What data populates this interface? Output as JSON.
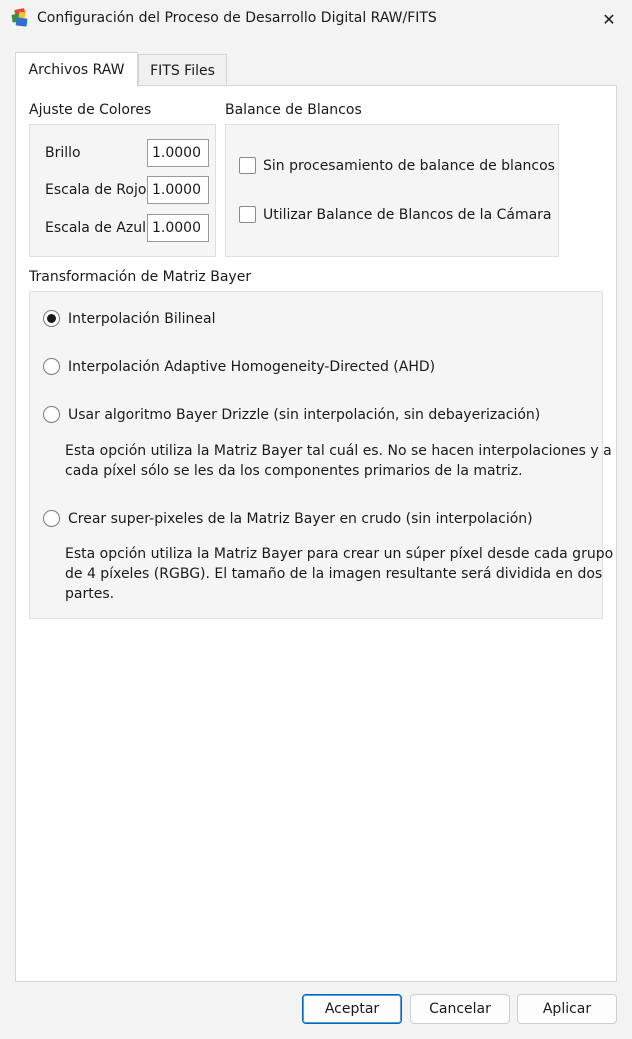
{
  "window": {
    "title": "Configuración del Proceso de Desarrollo Digital RAW/FITS",
    "close_glyph": "✕"
  },
  "tabs": [
    {
      "label": "Archivos RAW",
      "active": true
    },
    {
      "label": "FITS Files",
      "active": false
    }
  ],
  "color_adjust": {
    "group_label": "Ajuste de Colores",
    "brightness_label": "Brillo",
    "brightness_value": "1.0000",
    "red_scale_label": "Escala de Rojo",
    "red_scale_value": "1.0000",
    "blue_scale_label": "Escala de Azul",
    "blue_scale_value": "1.0000"
  },
  "white_balance": {
    "group_label": "Balance de Blancos",
    "no_processing_label": "Sin procesamiento de balance de blancos",
    "no_processing_checked": false,
    "camera_wb_label": "Utilizar Balance de Blancos de la Cámara",
    "camera_wb_checked": false
  },
  "bayer": {
    "group_label": "Transformación de Matriz Bayer",
    "options": [
      {
        "label": "Interpolación Bilineal",
        "selected": true
      },
      {
        "label": "Interpolación Adaptive Homogeneity-Directed (AHD)",
        "selected": false
      },
      {
        "label": "Usar algoritmo Bayer Drizzle (sin interpolación, sin debayerización)",
        "selected": false,
        "description": [
          "Esta opción utiliza la Matriz Bayer tal cuál es. No se hacen interpolaciones y a",
          "cada píxel sólo se les da los componentes primarios de la matriz."
        ]
      },
      {
        "label": "Crear super-pixeles de la Matriz Bayer en crudo (sin interpolación)",
        "selected": false,
        "description": [
          "Esta opción utiliza la Matriz Bayer para crear un súper píxel desde cada grupo",
          "de 4 píxeles (RGBG). El tamaño de la imagen resultante será dividida en dos",
          "partes."
        ]
      }
    ]
  },
  "buttons": {
    "accept": "Aceptar",
    "cancel": "Cancelar",
    "apply": "Aplicar"
  },
  "icons": {
    "app": "app-icon",
    "close": "close-icon"
  }
}
